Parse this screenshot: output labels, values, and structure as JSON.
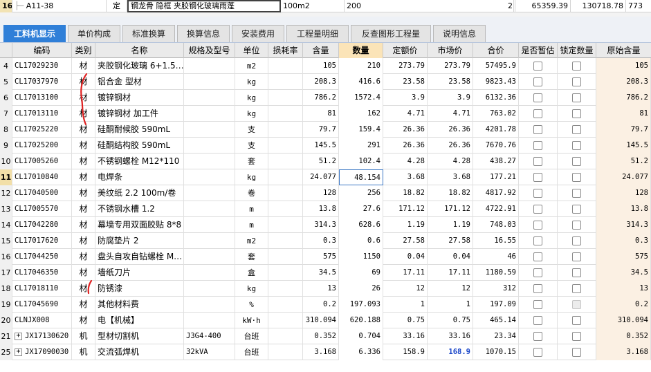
{
  "top_row": {
    "row_number": "16",
    "code": "A11-38",
    "kind": "定",
    "name": "钢龙骨 隐框 夹胶钢化玻璃雨蓬",
    "unit": "100m2",
    "quantity": "200",
    "col_a": "2",
    "col_b": "65359.39",
    "col_c": "130718.78",
    "col_d": "773"
  },
  "tabs": [
    {
      "label": "工料机显示",
      "active": true
    },
    {
      "label": "单价构成",
      "active": false
    },
    {
      "label": "标准换算",
      "active": false
    },
    {
      "label": "换算信息",
      "active": false
    },
    {
      "label": "安装费用",
      "active": false
    },
    {
      "label": "工程量明细",
      "active": false
    },
    {
      "label": "反查图形工程量",
      "active": false
    },
    {
      "label": "说明信息",
      "active": false
    }
  ],
  "columns": {
    "code": "编码",
    "type": "类别",
    "name": "名称",
    "spec": "规格及型号",
    "unit": "单位",
    "loss": "损耗率",
    "content": "含量",
    "quantity": "数量",
    "budget_price": "定额价",
    "market_price": "市场价",
    "total_price": "合价",
    "provisional": "是否暂估",
    "locked_qty": "锁定数量",
    "original_content": "原始含量"
  },
  "rows": [
    {
      "n": "4",
      "code": "CL17029230",
      "type": "材",
      "name": "夹胶钢化玻璃 6+1.5…",
      "spec": "",
      "unit": "m2",
      "content": "105",
      "qty": "210",
      "budget": "273.79",
      "market": "273.79",
      "total": "57495.9",
      "orig": "105"
    },
    {
      "n": "5",
      "code": "CL17037970",
      "type": "材",
      "name": "铝合金 型材",
      "spec": "",
      "unit": "kg",
      "content": "208.3",
      "qty": "416.6",
      "budget": "23.58",
      "market": "23.58",
      "total": "9823.43",
      "orig": "208.3"
    },
    {
      "n": "6",
      "code": "CL17013100",
      "type": "材",
      "name": "镀锌钢材",
      "spec": "",
      "unit": "kg",
      "content": "786.2",
      "qty": "1572.4",
      "budget": "3.9",
      "market": "3.9",
      "total": "6132.36",
      "orig": "786.2"
    },
    {
      "n": "7",
      "code": "CL17013110",
      "type": "材",
      "name": "镀锌钢材 加工件",
      "spec": "",
      "unit": "kg",
      "content": "81",
      "qty": "162",
      "budget": "4.71",
      "market": "4.71",
      "total": "763.02",
      "orig": "81"
    },
    {
      "n": "8",
      "code": "CL17025220",
      "type": "材",
      "name": "硅酮耐候胶 590mL",
      "spec": "",
      "unit": "支",
      "content": "79.7",
      "qty": "159.4",
      "budget": "26.36",
      "market": "26.36",
      "total": "4201.78",
      "orig": "79.7"
    },
    {
      "n": "9",
      "code": "CL17025200",
      "type": "材",
      "name": "硅酮结构胶 590mL",
      "spec": "",
      "unit": "支",
      "content": "145.5",
      "qty": "291",
      "budget": "26.36",
      "market": "26.36",
      "total": "7670.76",
      "orig": "145.5"
    },
    {
      "n": "10",
      "code": "CL17005260",
      "type": "材",
      "name": "不锈钢螺栓 M12*110",
      "spec": "",
      "unit": "套",
      "content": "51.2",
      "qty": "102.4",
      "budget": "4.28",
      "market": "4.28",
      "total": "438.27",
      "orig": "51.2"
    },
    {
      "n": "11",
      "code": "CL17010840",
      "type": "材",
      "name": "电焊条",
      "spec": "",
      "unit": "kg",
      "content": "24.077",
      "qty": "48.154",
      "budget": "3.68",
      "market": "3.68",
      "total": "177.21",
      "orig": "24.077"
    },
    {
      "n": "12",
      "code": "CL17040500",
      "type": "材",
      "name": "美纹纸 2.2 100m/卷",
      "spec": "",
      "unit": "卷",
      "content": "128",
      "qty": "256",
      "budget": "18.82",
      "market": "18.82",
      "total": "4817.92",
      "orig": "128"
    },
    {
      "n": "13",
      "code": "CL17005570",
      "type": "材",
      "name": "不锈钢水槽 1.2",
      "spec": "",
      "unit": "m",
      "content": "13.8",
      "qty": "27.6",
      "budget": "171.12",
      "market": "171.12",
      "total": "4722.91",
      "orig": "13.8"
    },
    {
      "n": "14",
      "code": "CL17042280",
      "type": "材",
      "name": "幕墙专用双面胶贴 8*8",
      "spec": "",
      "unit": "m",
      "content": "314.3",
      "qty": "628.6",
      "budget": "1.19",
      "market": "1.19",
      "total": "748.03",
      "orig": "314.3"
    },
    {
      "n": "15",
      "code": "CL17017620",
      "type": "材",
      "name": "防腐垫片 2",
      "spec": "",
      "unit": "m2",
      "content": "0.3",
      "qty": "0.6",
      "budget": "27.58",
      "market": "27.58",
      "total": "16.55",
      "orig": "0.3"
    },
    {
      "n": "16",
      "code": "CL17044250",
      "type": "材",
      "name": "盘头自攻自钻螺栓 M…",
      "spec": "",
      "unit": "套",
      "content": "575",
      "qty": "1150",
      "budget": "0.04",
      "market": "0.04",
      "total": "46",
      "orig": "575"
    },
    {
      "n": "17",
      "code": "CL17046350",
      "type": "材",
      "name": "墙纸刀片",
      "spec": "",
      "unit": "盒",
      "content": "34.5",
      "qty": "69",
      "budget": "17.11",
      "market": "17.11",
      "total": "1180.59",
      "orig": "34.5"
    },
    {
      "n": "18",
      "code": "CL17018110",
      "type": "材",
      "name": "防锈漆",
      "spec": "",
      "unit": "kg",
      "content": "13",
      "qty": "26",
      "budget": "12",
      "market": "12",
      "total": "312",
      "orig": "13"
    },
    {
      "n": "19",
      "code": "CL17045690",
      "type": "材",
      "name": "其他材料费",
      "spec": "",
      "unit": "%",
      "content": "0.2",
      "qty": "197.093",
      "budget": "1",
      "market": "1",
      "total": "197.09",
      "orig": "0.2"
    },
    {
      "n": "20",
      "code": "CLNJX008",
      "type": "材",
      "name": "电【机械】",
      "spec": "",
      "unit": "kW·h",
      "content": "310.094",
      "qty": "620.188",
      "budget": "0.75",
      "market": "0.75",
      "total": "465.14",
      "orig": "310.094"
    },
    {
      "n": "21",
      "code": "JX17130620",
      "type": "机",
      "name": "型材切割机",
      "spec": "J3G4-400",
      "unit": "台班",
      "content": "0.352",
      "qty": "0.704",
      "budget": "33.16",
      "market": "33.16",
      "total": "23.34",
      "orig": "0.352"
    },
    {
      "n": "25",
      "code": "JX17090030",
      "type": "机",
      "name": "交流弧焊机",
      "spec": "32kVA",
      "unit": "台班",
      "content": "3.168",
      "qty": "6.336",
      "budget": "158.9",
      "market": "168.9",
      "total": "1070.15",
      "orig": "3.168"
    }
  ],
  "expander_symbol": "+",
  "colors": {
    "active_tab": "#2f7fd8",
    "header_highlight": "#fbe4b8",
    "market_highlight": "#1844c8",
    "annotation": "#e02020"
  }
}
